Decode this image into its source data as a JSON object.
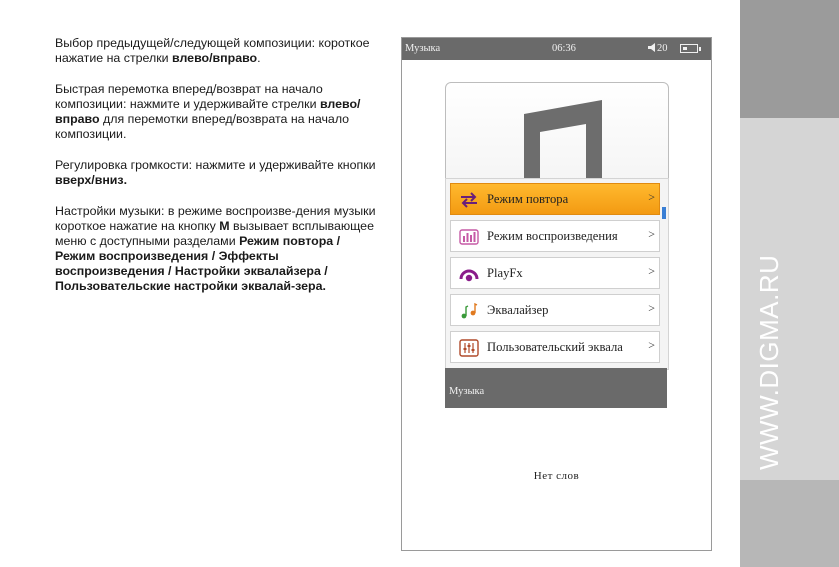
{
  "manual": {
    "p1": {
      "text": "Выбор предыдущей/следующей композиции: короткое нажатие на стрелки ",
      "bold": "влево/вправо",
      "tail": "."
    },
    "p2": {
      "text": "Быстрая перемотка вперед/возврат на начало композиции: нажмите и удерживайте стрелки ",
      "bold": "влево/вправо",
      "tail": " для перемотки вперед/возврата на начало композиции."
    },
    "p3": {
      "text": "Регулировка громкости: нажмите и удерживайте кнопки ",
      "bold": "вверх/вниз."
    },
    "p4": {
      "text": "Настройки музыки: в режиме воспроизве-дения музыки короткое нажатие на кнопку ",
      "key": "M",
      "mid": " вызывает всплывающее меню с доступными разделами ",
      "bold": "Режим повтора / Режим воспроизведения / Эффекты воспроизведения / Настройки эквалайзера / Пользовательские настройки эквалай-зера."
    }
  },
  "site": "WWW.DIGMA.RU",
  "device": {
    "status": {
      "title": "Музыка",
      "time": "06:36",
      "volume": "20",
      "volume_icon": "speaker-icon",
      "battery_icon": "battery-icon"
    },
    "menu": [
      {
        "label": "Режим повтора",
        "icon": "repeat-icon",
        "active": true
      },
      {
        "label": "Режим воспроизведения",
        "icon": "equalizer-bars-icon",
        "active": false
      },
      {
        "label": "PlayFx",
        "icon": "headphones-icon",
        "active": false
      },
      {
        "label": "Эквалайзер",
        "icon": "music-notes-icon",
        "active": false
      },
      {
        "label": "Пользовательский эквала",
        "icon": "sliders-icon",
        "active": false
      }
    ],
    "chevron": ">",
    "bottom_label": "Музыка",
    "lyrics": "Нет слов"
  },
  "colors": {
    "accent": "#f39a12",
    "statusbar": "#6a6a6a",
    "scroll": "#3a7fd5"
  }
}
